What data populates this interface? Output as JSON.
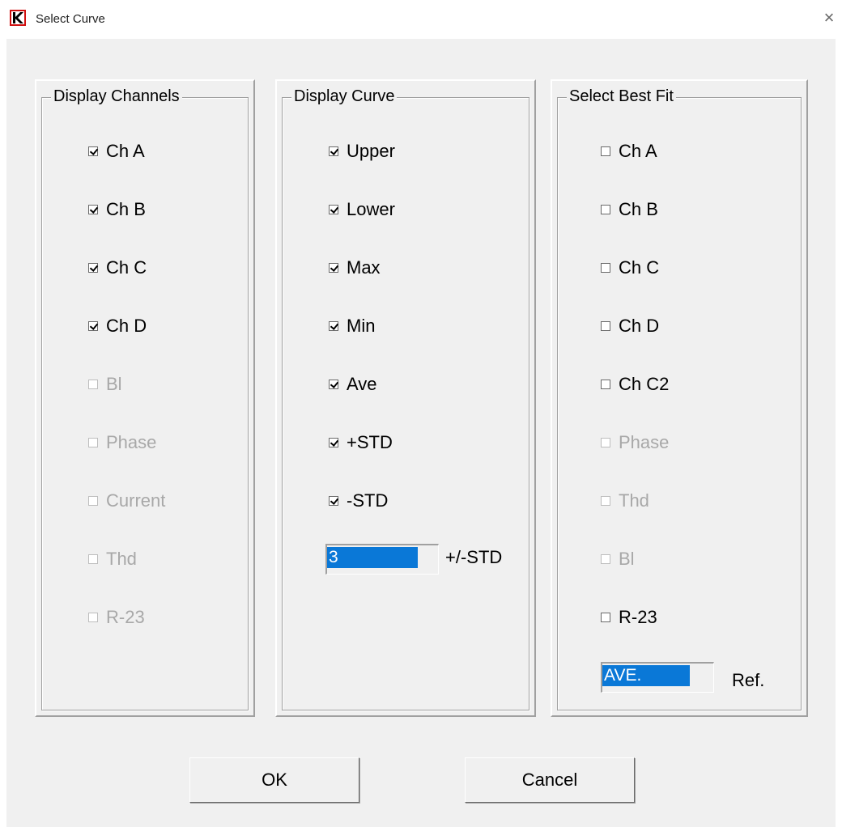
{
  "window": {
    "title": "Select Curve",
    "close_icon": "×"
  },
  "panels": {
    "channels": {
      "legend": "Display Channels",
      "items": [
        {
          "label": "Ch A",
          "checked": true,
          "enabled": true
        },
        {
          "label": "Ch B",
          "checked": true,
          "enabled": true
        },
        {
          "label": "Ch C",
          "checked": true,
          "enabled": true
        },
        {
          "label": "Ch D",
          "checked": true,
          "enabled": true
        },
        {
          "label": "Bl",
          "checked": false,
          "enabled": false
        },
        {
          "label": "Phase",
          "checked": false,
          "enabled": false
        },
        {
          "label": "Current",
          "checked": false,
          "enabled": false
        },
        {
          "label": "Thd",
          "checked": false,
          "enabled": false
        },
        {
          "label": "R-23",
          "checked": false,
          "enabled": false
        }
      ]
    },
    "curve": {
      "legend": "Display Curve",
      "items": [
        {
          "label": "Upper",
          "checked": true,
          "enabled": true
        },
        {
          "label": "Lower",
          "checked": true,
          "enabled": true
        },
        {
          "label": "Max",
          "checked": true,
          "enabled": true
        },
        {
          "label": "Min",
          "checked": true,
          "enabled": true
        },
        {
          "label": "Ave",
          "checked": true,
          "enabled": true
        },
        {
          "label": "+STD",
          "checked": true,
          "enabled": true
        },
        {
          "label": "-STD",
          "checked": true,
          "enabled": true
        }
      ],
      "std_value": "3",
      "std_label": "+/-STD"
    },
    "bestfit": {
      "legend": "Select Best Fit",
      "items": [
        {
          "label": "Ch A",
          "checked": false,
          "enabled": true
        },
        {
          "label": "Ch B",
          "checked": false,
          "enabled": true
        },
        {
          "label": "Ch C",
          "checked": false,
          "enabled": true
        },
        {
          "label": "Ch D",
          "checked": false,
          "enabled": true
        },
        {
          "label": "Ch C2",
          "checked": false,
          "enabled": true
        },
        {
          "label": "Phase",
          "checked": false,
          "enabled": false
        },
        {
          "label": "Thd",
          "checked": false,
          "enabled": false
        },
        {
          "label": "Bl",
          "checked": false,
          "enabled": false
        },
        {
          "label": "R-23",
          "checked": false,
          "enabled": true
        }
      ],
      "ref_value": "AVE.",
      "ref_label": "Ref."
    }
  },
  "buttons": {
    "ok": "OK",
    "cancel": "Cancel"
  },
  "colors": {
    "accent": "#0a78d7",
    "dialog_bg": "#f0f0f0",
    "logo_red": "#d01010"
  }
}
